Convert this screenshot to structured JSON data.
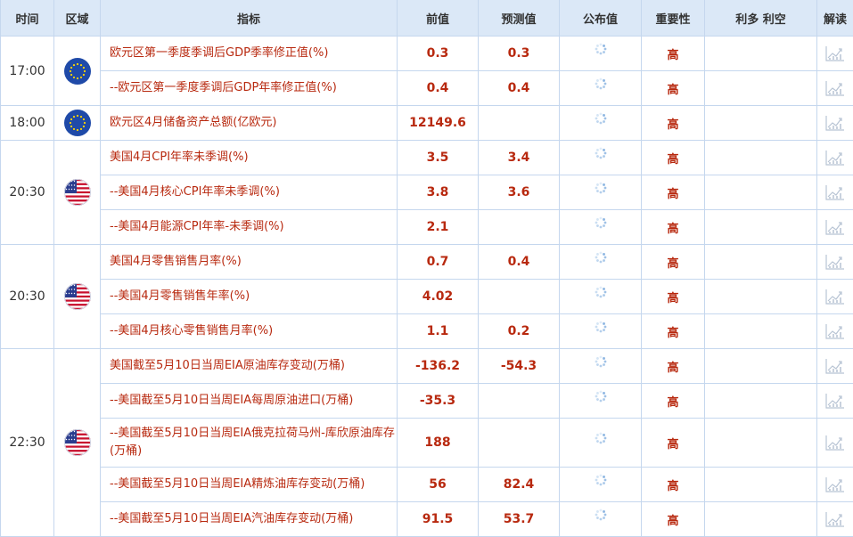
{
  "header": {
    "time": "时间",
    "region": "区域",
    "indicator": "指标",
    "previous": "前值",
    "forecast": "预测值",
    "actual": "公布值",
    "importance": "重要性",
    "effect": "利多 利空",
    "analysis": "解读"
  },
  "colors": {
    "header_bg": "#dbe8f7",
    "grid": "#c5d7ee",
    "value_red": "#b8290f"
  },
  "rows": [
    {
      "time": "17:00",
      "flag": "eu-flag",
      "indicator": "欧元区第一季度季调后GDP季率修正值(%)",
      "previous": "0.3",
      "forecast": "0.3",
      "actual": "",
      "importance": "高",
      "effect": ""
    },
    {
      "indicator": "--欧元区第一季度季调后GDP年率修正值(%)",
      "previous": "0.4",
      "forecast": "0.4",
      "actual": "",
      "importance": "高",
      "effect": ""
    },
    {
      "time": "18:00",
      "flag": "eu-flag",
      "indicator": "欧元区4月储备资产总额(亿欧元)",
      "previous": "12149.6",
      "forecast": "",
      "actual": "",
      "importance": "高",
      "effect": ""
    },
    {
      "time": "20:30",
      "flag": "us-flag",
      "indicator": "美国4月CPI年率未季调(%)",
      "previous": "3.5",
      "forecast": "3.4",
      "actual": "",
      "importance": "高",
      "effect": ""
    },
    {
      "indicator": "--美国4月核心CPI年率未季调(%)",
      "previous": "3.8",
      "forecast": "3.6",
      "actual": "",
      "importance": "高",
      "effect": ""
    },
    {
      "indicator": "--美国4月能源CPI年率-未季调(%)",
      "previous": "2.1",
      "forecast": "",
      "actual": "",
      "importance": "高",
      "effect": ""
    },
    {
      "time": "20:30",
      "flag": "us-flag",
      "indicator": "美国4月零售销售月率(%)",
      "previous": "0.7",
      "forecast": "0.4",
      "actual": "",
      "importance": "高",
      "effect": ""
    },
    {
      "indicator": "--美国4月零售销售年率(%)",
      "previous": "4.02",
      "forecast": "",
      "actual": "",
      "importance": "高",
      "effect": ""
    },
    {
      "indicator": "--美国4月核心零售销售月率(%)",
      "previous": "1.1",
      "forecast": "0.2",
      "actual": "",
      "importance": "高",
      "effect": ""
    },
    {
      "time": "22:30",
      "flag": "us-flag",
      "indicator": "美国截至5月10日当周EIA原油库存变动(万桶)",
      "previous": "-136.2",
      "forecast": "-54.3",
      "actual": "",
      "importance": "高",
      "effect": ""
    },
    {
      "indicator": "--美国截至5月10日当周EIA每周原油进口(万桶)",
      "previous": "-35.3",
      "forecast": "",
      "actual": "",
      "importance": "高",
      "effect": ""
    },
    {
      "indicator": "--美国截至5月10日当周EIA俄克拉荷马州-库欣原油库存(万桶)",
      "previous": "188",
      "forecast": "",
      "actual": "",
      "importance": "高",
      "effect": ""
    },
    {
      "indicator": "--美国截至5月10日当周EIA精炼油库存变动(万桶)",
      "previous": "56",
      "forecast": "82.4",
      "actual": "",
      "importance": "高",
      "effect": ""
    },
    {
      "indicator": "--美国截至5月10日当周EIA汽油库存变动(万桶)",
      "previous": "91.5",
      "forecast": "53.7",
      "actual": "",
      "importance": "高",
      "effect": ""
    }
  ]
}
